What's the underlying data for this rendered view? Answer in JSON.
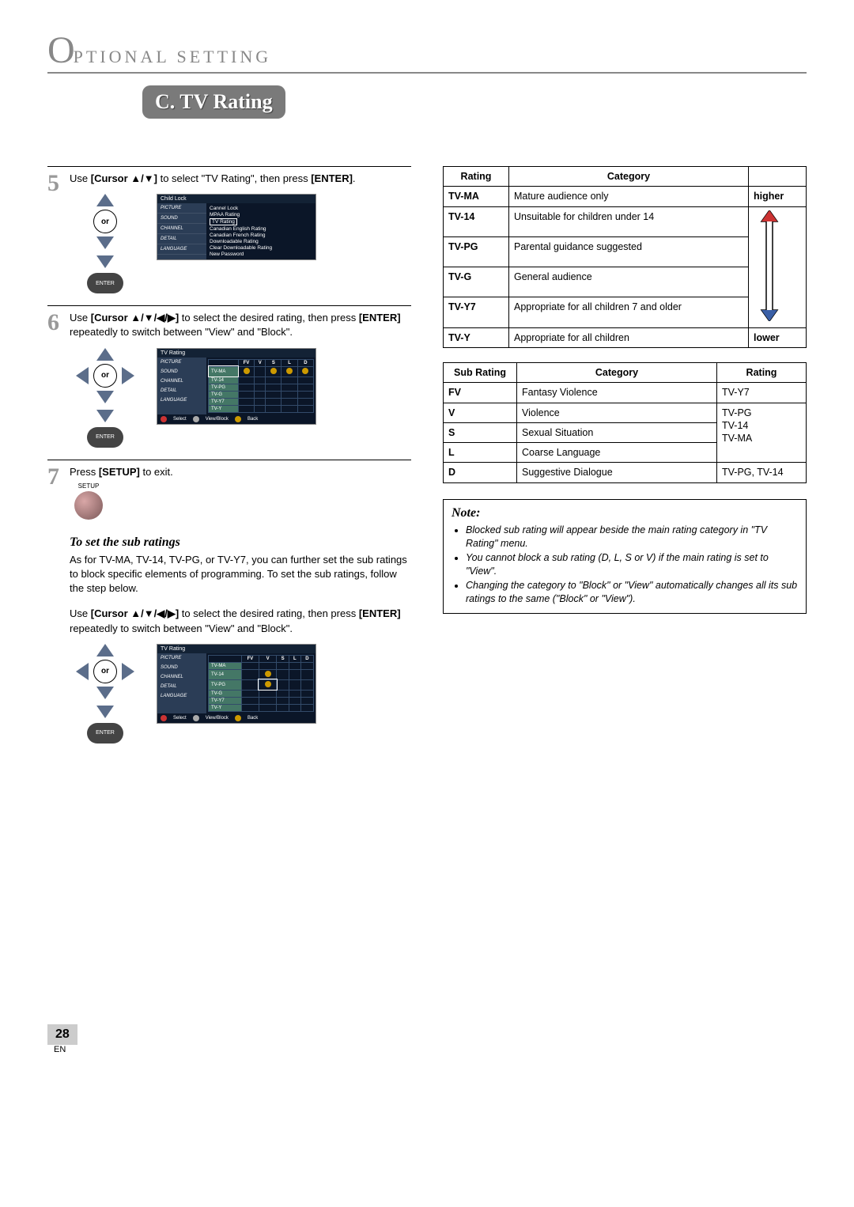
{
  "header": {
    "titleRest": "PTIONAL   SETTING"
  },
  "banner": "C. TV Rating",
  "steps": {
    "s5": {
      "num": "5",
      "text_a": "Use ",
      "text_b": "[Cursor ▲/▼]",
      "text_c": " to select \"TV Rating\", then press ",
      "text_d": "[ENTER]",
      "text_e": ".",
      "padOr": "or",
      "enter": "ENTER",
      "osdTitle": "Child Lock",
      "osdLeft": [
        "PICTURE",
        "SOUND",
        "CHANNEL",
        "DETAIL",
        "LANGUAGE"
      ],
      "osdItems": [
        "Cannel Lock",
        "MPAA Rating",
        "TV Rating",
        "Canadian English Rating",
        "Canadian French Rating",
        "Downloadable Rating",
        "Clear Downloadable Rating",
        "New Password"
      ]
    },
    "s6": {
      "num": "6",
      "text_a": "Use ",
      "text_b": "[Cursor ▲/▼/◀/▶]",
      "text_c": " to select the desired rating, then press ",
      "text_d": "[ENTER]",
      "text_e": " repeatedly to switch between \"View\" and \"Block\".",
      "padOr": "or",
      "enter": "ENTER",
      "osdTitle": "TV Rating",
      "osdLeft": [
        "PICTURE",
        "SOUND",
        "CHANNEL",
        "DETAIL",
        "LANGUAGE"
      ],
      "gridCols": [
        "",
        "FV",
        "V",
        "S",
        "L",
        "D"
      ],
      "gridRows": [
        "TV-MA",
        "TV-14",
        "TV-PG",
        "TV-G",
        "TV-Y7",
        "TV-Y"
      ],
      "footSelect": "Select",
      "footView": "View/Block",
      "footBack": "Back"
    },
    "s7": {
      "num": "7",
      "text_a": "Press ",
      "text_b": "[SETUP]",
      "text_c": " to exit.",
      "setupLabel": "SETUP"
    }
  },
  "subRatings": {
    "heading": "To set the sub ratings",
    "para1": "As for TV-MA, TV-14, TV-PG, or TV-Y7, you can further set the sub ratings to block specific elements of programming. To set the sub ratings, follow the step below.",
    "para2_a": "Use ",
    "para2_b": "[Cursor ▲/▼/◀/▶]",
    "para2_c": " to select the desired rating, then press ",
    "para2_d": "[ENTER]",
    "para2_e": " repeatedly to switch between \"View\" and \"Block\".",
    "padOr": "or",
    "enter": "ENTER",
    "osdTitle": "TV Rating",
    "osdLeft": [
      "PICTURE",
      "SOUND",
      "CHANNEL",
      "DETAIL",
      "LANGUAGE"
    ],
    "gridCols": [
      "",
      "FV",
      "V",
      "S",
      "L",
      "D"
    ],
    "gridRows": [
      "TV-MA",
      "TV-14",
      "TV-PG",
      "TV-G",
      "TV-Y7",
      "TV-Y"
    ],
    "footSelect": "Select",
    "footView": "View/Block",
    "footBack": "Back"
  },
  "ratingTable": {
    "head": [
      "Rating",
      "Category",
      ""
    ],
    "rows": [
      {
        "k": "TV-MA",
        "v": "Mature audience only"
      },
      {
        "k": "TV-14",
        "v": "Unsuitable for children under 14"
      },
      {
        "k": "TV-PG",
        "v": "Parental guidance suggested"
      },
      {
        "k": "TV-G",
        "v": "General audience"
      },
      {
        "k": "TV-Y7",
        "v": "Appropriate for all children 7 and older"
      },
      {
        "k": "TV-Y",
        "v": "Appropriate for all children"
      }
    ],
    "topLabel": "higher",
    "bottomLabel": "lower"
  },
  "subTable": {
    "head": [
      "Sub Rating",
      "Category",
      "Rating"
    ],
    "rows": [
      {
        "k": "FV",
        "v": "Fantasy Violence",
        "r": "TV-Y7"
      },
      {
        "k": "V",
        "v": "Violence",
        "r": ""
      },
      {
        "k": "S",
        "v": "Sexual Situation",
        "r": ""
      },
      {
        "k": "L",
        "v": "Coarse Language",
        "r": ""
      },
      {
        "k": "D",
        "v": "Suggestive Dialogue",
        "r": "TV-PG, TV-14"
      }
    ],
    "mergedRating": "TV-PG\nTV-14\nTV-MA"
  },
  "note": {
    "title": "Note:",
    "items": [
      "Blocked sub rating will appear beside the main rating category in \"TV Rating\" menu.",
      "You cannot block a sub rating (D, L, S or V) if the main rating is set to \"View\".",
      "Changing the category to \"Block\" or \"View\" automatically changes all its sub ratings to the same (\"Block\" or \"View\")."
    ]
  },
  "footer": {
    "page": "28",
    "lang": "EN"
  }
}
